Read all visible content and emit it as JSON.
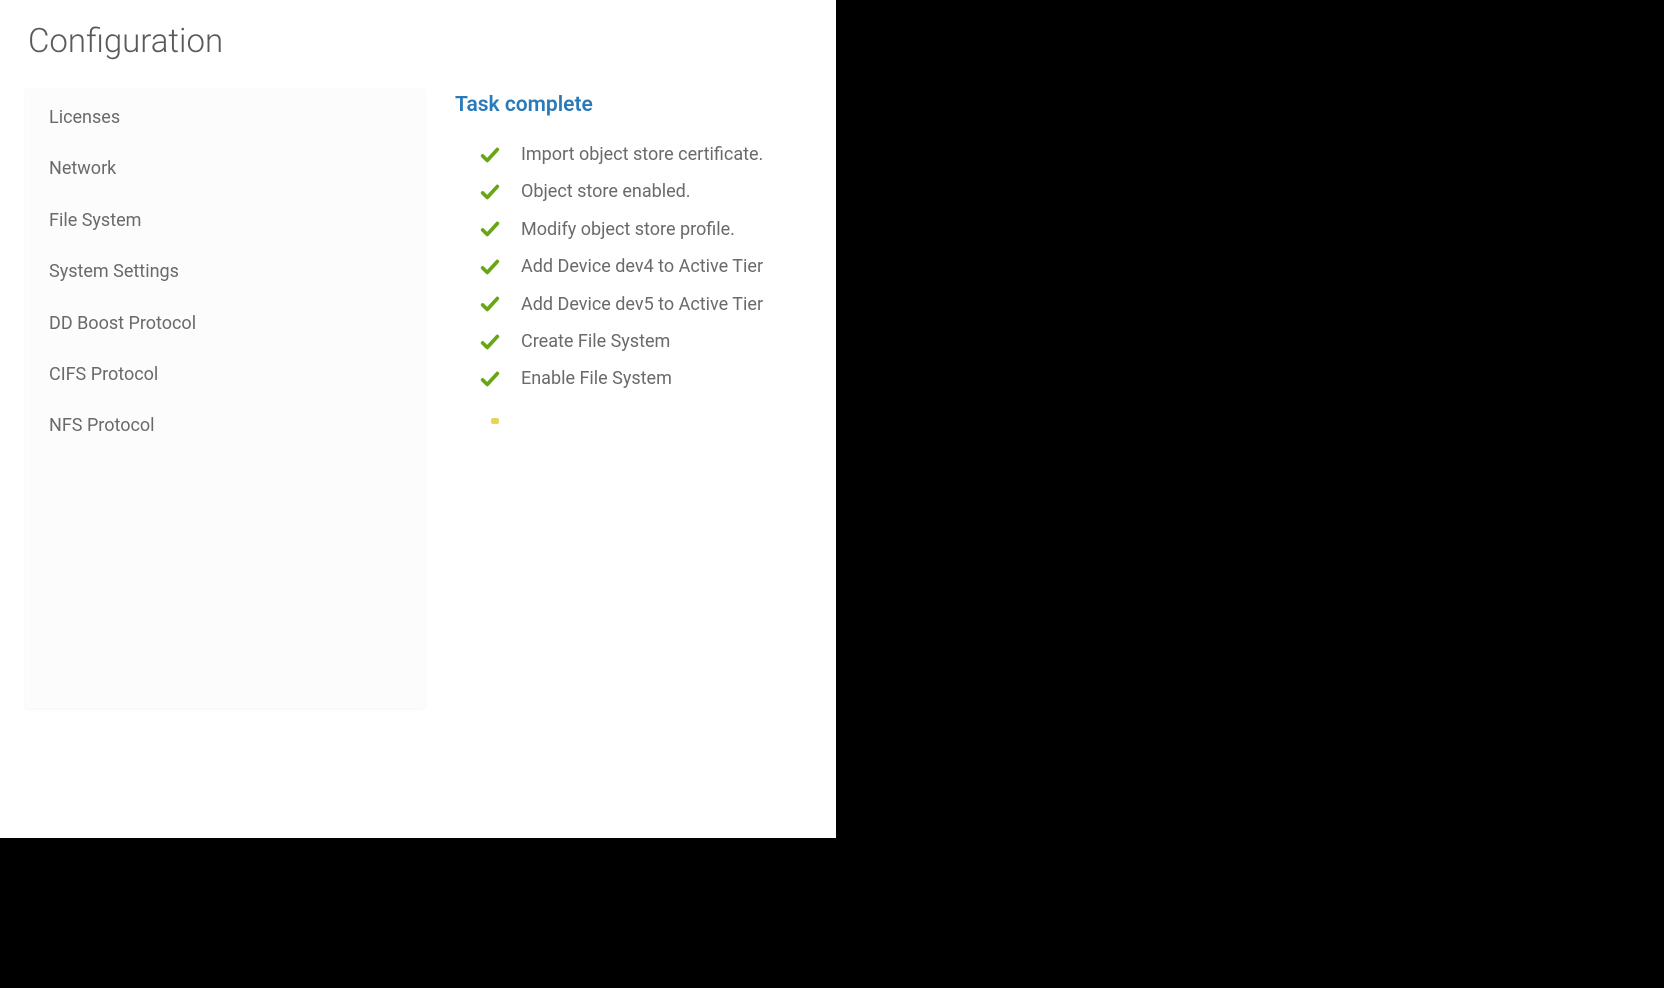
{
  "page": {
    "title": "Configuration"
  },
  "sidebar": {
    "items": [
      {
        "label": "Licenses"
      },
      {
        "label": "Network"
      },
      {
        "label": "File System"
      },
      {
        "label": "System Settings"
      },
      {
        "label": "DD Boost Protocol"
      },
      {
        "label": "CIFS Protocol"
      },
      {
        "label": "NFS Protocol"
      }
    ]
  },
  "main": {
    "heading": "Task complete",
    "tasks": [
      {
        "label": "Import object store certificate.",
        "status": "done"
      },
      {
        "label": "Object store enabled.",
        "status": "done"
      },
      {
        "label": "Modify object store profile.",
        "status": "done"
      },
      {
        "label": "Add Device dev4 to Active Tier",
        "status": "done"
      },
      {
        "label": "Add Device dev5 to Active Tier",
        "status": "done"
      },
      {
        "label": "Create File System",
        "status": "done"
      },
      {
        "label": "Enable File System",
        "status": "done"
      }
    ]
  }
}
